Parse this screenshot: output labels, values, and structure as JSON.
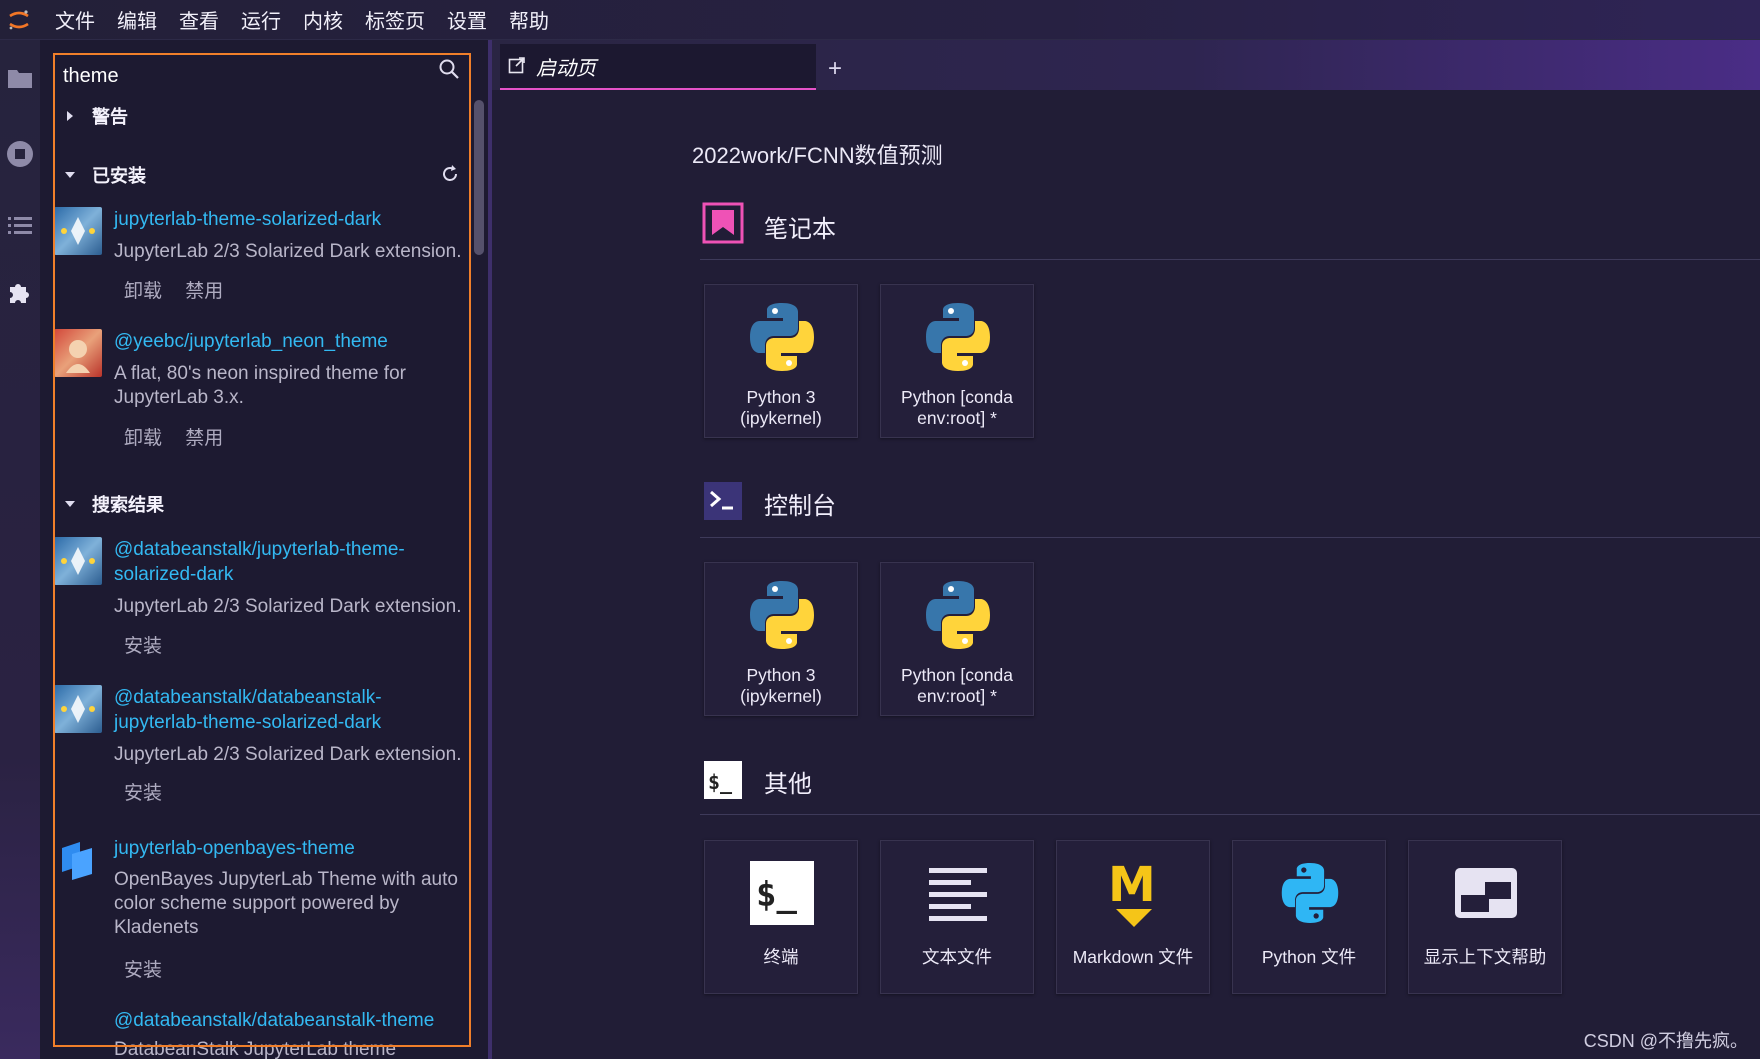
{
  "menu": [
    "文件",
    "编辑",
    "查看",
    "运行",
    "内核",
    "标签页",
    "设置",
    "帮助"
  ],
  "search": {
    "value": "theme"
  },
  "sections": {
    "warnings": "警告",
    "installed": "已安装",
    "results": "搜索结果"
  },
  "installed": [
    {
      "name": "jupyterlab-theme-solarized-dark",
      "desc": "JupyterLab 2/3 Solarized Dark extension.",
      "uninstall": "卸载",
      "disable": "禁用"
    },
    {
      "name": "@yeebc/jupyterlab_neon_theme",
      "desc": "A flat, 80's neon inspired theme for JupyterLab 3.x.",
      "uninstall": "卸载",
      "disable": "禁用"
    }
  ],
  "results": [
    {
      "name": "@databeanstalk/jupyterlab-theme-solarized-dark",
      "desc": "JupyterLab 2/3 Solarized Dark extension.",
      "install": "安装"
    },
    {
      "name": "@databeanstalk/databeanstalk-jupyterlab-theme-solarized-dark",
      "desc": "JupyterLab 2/3 Solarized Dark extension.",
      "install": "安装"
    },
    {
      "name": "jupyterlab-openbayes-theme",
      "desc": "OpenBayes JupyterLab Theme with auto color scheme support powered by Kladenets",
      "install": "安装"
    },
    {
      "name": "@databeanstalk/databeanstalk-theme",
      "desc": "DatabeanStalk JupyterLab theme"
    }
  ],
  "tab": {
    "label": "启动页",
    "add": "+"
  },
  "launcher": {
    "path": "2022work/FCNN数值预测",
    "notebook_title": "笔记本",
    "console_title": "控制台",
    "other_title": "其他",
    "notebook_cards": [
      "Python 3\n(ipykernel)",
      "Python [conda\nenv:root] *"
    ],
    "console_cards": [
      "Python 3\n(ipykernel)",
      "Python [conda\nenv:root] *"
    ],
    "other_cards": [
      "终端",
      "文本文件",
      "Markdown 文件",
      "Python 文件",
      "显示上下文帮助"
    ]
  },
  "watermark": "CSDN @不撸先疯。",
  "colors": {
    "accent_orange": "#f07f2a",
    "link_blue": "#33b9f2",
    "tab_underline": "#e552c8",
    "python_blue": "#3776ab",
    "python_yellow": "#ffd43b",
    "markdown_yellow": "#f5c518"
  }
}
